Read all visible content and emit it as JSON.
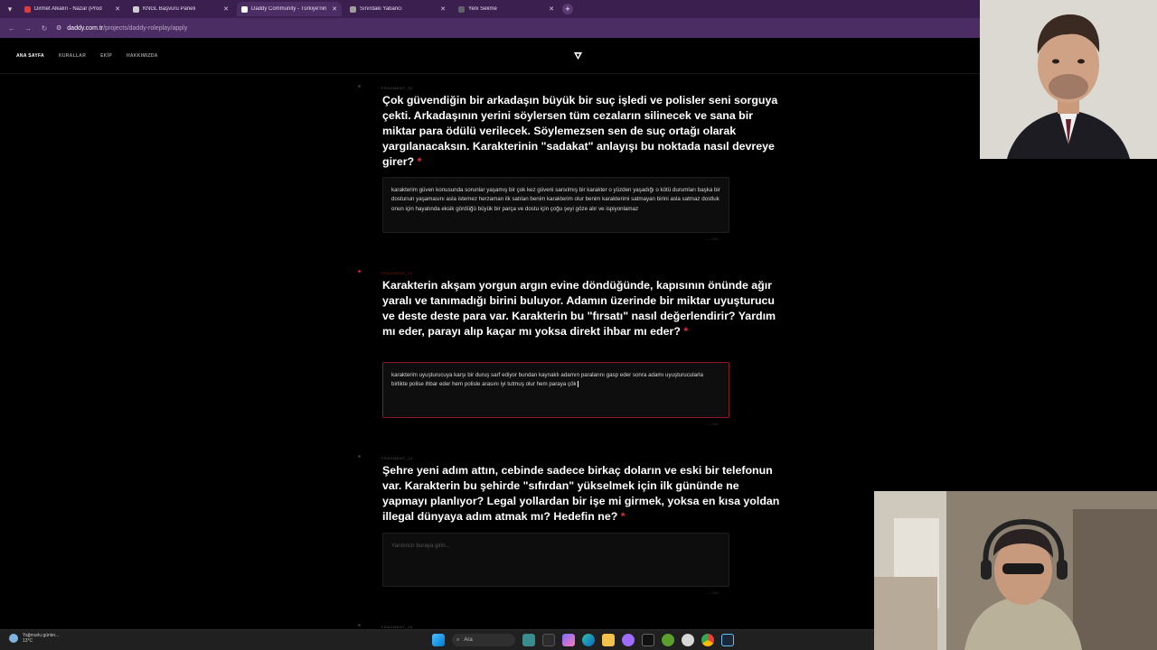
{
  "browser": {
    "tabs": [
      {
        "label": "Dirmet Alkalın - Nazar (Prod",
        "favicon_color": "#e53935",
        "active": false
      },
      {
        "label": "KNGL Başvuru Paneli",
        "favicon_color": "#cfcfcf",
        "active": false
      },
      {
        "label": "Daddy Community - Türkiye'nin",
        "favicon_color": "#ffffff",
        "active": true
      },
      {
        "label": "Sınırdaki Yabancı",
        "favicon_color": "#9e9e9e",
        "active": false
      },
      {
        "label": "Yeni Sekme",
        "favicon_color": "#5f6368",
        "active": false
      }
    ],
    "url_domain": "daddy.com.tr",
    "url_path": "/projects/daddy-roleplay/apply"
  },
  "site": {
    "nav": [
      "ANA SAYFA",
      "KURALLAR",
      "EKİP",
      "HAKKIMIZDA"
    ],
    "logo_icon": "daddy-logo-icon"
  },
  "questions": [
    {
      "fragment": "FRAGMENT_12",
      "title": "Çok güvendiğin bir arkadaşın büyük bir suç işledi ve polisler seni sorguya çekti. Arkadaşının yerini söylersen tüm cezaların silinecek ve sana bir miktar para ödülü verilecek. Söylemezsen sen de suç ortağı olarak yargılanacaksın. Karakterinin \"sadakat\" anlayışı bu noktada nasıl devreye girer?",
      "required": "*",
      "answer": "karakterim güven konusunda sorunlar yaşamış bir çok kez güveni sarsılmış bir karakter o yüzden yaşadığı o kötü durumları başka bir dostunun yaşamasını asla istemez herzaman ilk satılan benim karakterim olur benim karakterimi satmayan birini asla satmaz dostluk onun için hayatında eksik gördüğü büyük bir parça ve dostu için çoğu şeyi göze alır ve ispiyonlamaz",
      "counter": "— / 2000"
    },
    {
      "fragment": "FRAGMENT_13",
      "title": "Karakterin akşam yorgun argın evine döndüğünde, kapısının önünde ağır yaralı ve tanımadığı birini buluyor. Adamın üzerinde bir miktar uyuşturucu ve deste deste para var. Karakterin bu \"fırsatı\" nasıl değerlendirir? Yardım mı eder, parayı alıp kaçar mı yoksa direkt ihbar mı eder?",
      "required": "*",
      "answer": "karakterim uyuşturucuya karşı bir duruş sarf ediyor bundan kaynaklı adamın paralarını gasp eder sonra adamı uyuşturucularla birlikte polise ihbar eder hem polisle arasını iyi tutmuş olur hem paraya çök",
      "counter": "— / 2000"
    },
    {
      "fragment": "FRAGMENT_14",
      "title": "Şehre yeni adım attın, cebinde sadece birkaç doların ve eski bir telefonun var. Karakterin bu şehirde \"sıfırdan\" yükselmek için ilk gününde ne yapmayı planlıyor? Legal yollardan bir işe mi girmek, yoksa en kısa yoldan illegal dünyaya adım atmak mı? Hedefin ne?",
      "required": "*",
      "placeholder": "Yanıtınızı buraya girin...",
      "counter": "— / 2000"
    }
  ],
  "next_fragment": "FRAGMENT_15",
  "taskbar": {
    "weather_line1": "Yağmurlu günler...",
    "weather_line2": "13°C",
    "search_label": "Ara"
  },
  "colors": {
    "accent_red": "#e0303a",
    "tab_bar": "#3a1f4f",
    "address_bar": "#4b2c63"
  }
}
